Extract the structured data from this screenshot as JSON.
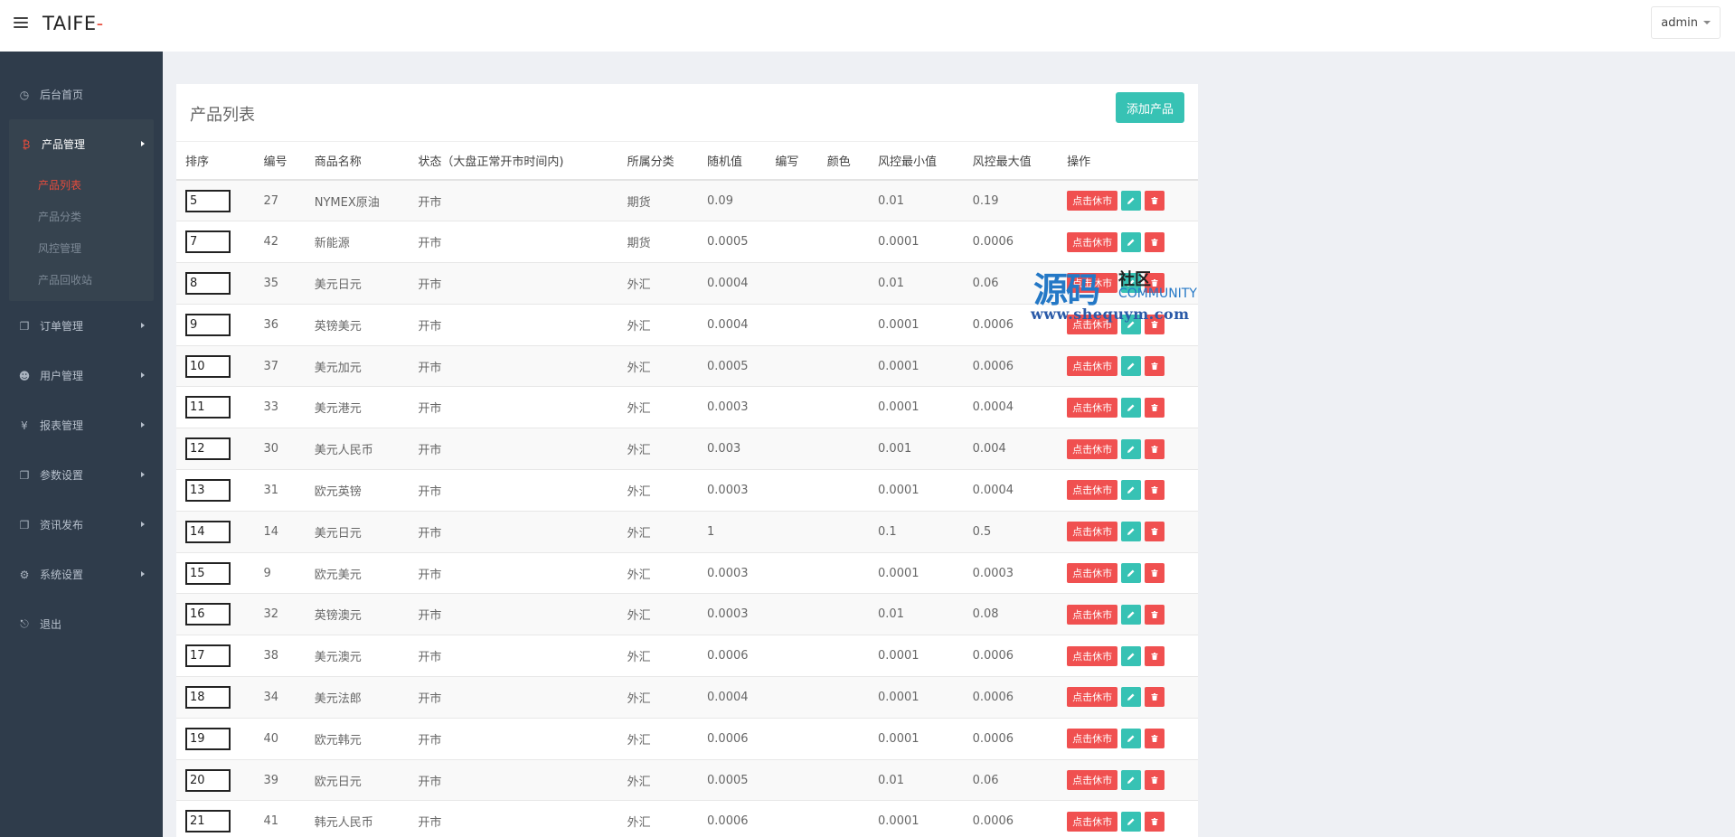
{
  "header": {
    "brand": "TAIFE",
    "brand_dash": "-",
    "user": "admin"
  },
  "sidebar": {
    "items": [
      {
        "label": "后台首页",
        "icon": "dashboard-icon",
        "glyph": "◷"
      },
      {
        "label": "产品管理",
        "icon": "bitcoin-icon",
        "glyph": "₿"
      },
      {
        "label": "订单管理",
        "icon": "copy-icon",
        "glyph": "❐"
      },
      {
        "label": "用户管理",
        "icon": "user-icon",
        "glyph": "☻"
      },
      {
        "label": "报表管理",
        "icon": "yen-icon",
        "glyph": "¥"
      },
      {
        "label": "参数设置",
        "icon": "copy-icon",
        "glyph": "❐"
      },
      {
        "label": "资讯发布",
        "icon": "copy-icon",
        "glyph": "❐"
      },
      {
        "label": "系统设置",
        "icon": "gears-icon",
        "glyph": "⚙"
      },
      {
        "label": "退出",
        "icon": "sign-out-icon",
        "glyph": "⎋"
      }
    ],
    "sub_items": [
      "产品列表",
      "产品分类",
      "风控管理",
      "产品回收站"
    ]
  },
  "main": {
    "title": "产品列表",
    "add_button": "添加产品",
    "columns": [
      "排序",
      "编号",
      "商品名称",
      "状态（大盘正常开市时间内)",
      "所属分类",
      "随机值",
      "编写",
      "颜色",
      "风控最小值",
      "风控最大值",
      "操作"
    ],
    "pause_label": "点击休市",
    "rows": [
      {
        "sort": "5",
        "id": "27",
        "name": "NYMEX原油",
        "status": "开市",
        "category": "期货",
        "random": "0.09",
        "code": "",
        "color": "",
        "min": "0.01",
        "max": "0.19"
      },
      {
        "sort": "7",
        "id": "42",
        "name": "新能源",
        "status": "开市",
        "category": "期货",
        "random": "0.0005",
        "code": "",
        "color": "",
        "min": "0.0001",
        "max": "0.0006"
      },
      {
        "sort": "8",
        "id": "35",
        "name": "美元日元",
        "status": "开市",
        "category": "外汇",
        "random": "0.0004",
        "code": "",
        "color": "",
        "min": "0.01",
        "max": "0.06"
      },
      {
        "sort": "9",
        "id": "36",
        "name": "英镑美元",
        "status": "开市",
        "category": "外汇",
        "random": "0.0004",
        "code": "",
        "color": "",
        "min": "0.0001",
        "max": "0.0006"
      },
      {
        "sort": "10",
        "id": "37",
        "name": "美元加元",
        "status": "开市",
        "category": "外汇",
        "random": "0.0005",
        "code": "",
        "color": "",
        "min": "0.0001",
        "max": "0.0006"
      },
      {
        "sort": "11",
        "id": "33",
        "name": "美元港元",
        "status": "开市",
        "category": "外汇",
        "random": "0.0003",
        "code": "",
        "color": "",
        "min": "0.0001",
        "max": "0.0004"
      },
      {
        "sort": "12",
        "id": "30",
        "name": "美元人民币",
        "status": "开市",
        "category": "外汇",
        "random": "0.003",
        "code": "",
        "color": "",
        "min": "0.001",
        "max": "0.004"
      },
      {
        "sort": "13",
        "id": "31",
        "name": "欧元英镑",
        "status": "开市",
        "category": "外汇",
        "random": "0.0003",
        "code": "",
        "color": "",
        "min": "0.0001",
        "max": "0.0004"
      },
      {
        "sort": "14",
        "id": "14",
        "name": "美元日元",
        "status": "开市",
        "category": "外汇",
        "random": "1",
        "code": "",
        "color": "",
        "min": "0.1",
        "max": "0.5"
      },
      {
        "sort": "15",
        "id": "9",
        "name": "欧元美元",
        "status": "开市",
        "category": "外汇",
        "random": "0.0003",
        "code": "",
        "color": "",
        "min": "0.0001",
        "max": "0.0003"
      },
      {
        "sort": "16",
        "id": "32",
        "name": "英镑澳元",
        "status": "开市",
        "category": "外汇",
        "random": "0.0003",
        "code": "",
        "color": "",
        "min": "0.01",
        "max": "0.08"
      },
      {
        "sort": "17",
        "id": "38",
        "name": "美元澳元",
        "status": "开市",
        "category": "外汇",
        "random": "0.0006",
        "code": "",
        "color": "",
        "min": "0.0001",
        "max": "0.0006"
      },
      {
        "sort": "18",
        "id": "34",
        "name": "美元法郎",
        "status": "开市",
        "category": "外汇",
        "random": "0.0004",
        "code": "",
        "color": "",
        "min": "0.0001",
        "max": "0.0006"
      },
      {
        "sort": "19",
        "id": "40",
        "name": "欧元韩元",
        "status": "开市",
        "category": "外汇",
        "random": "0.0006",
        "code": "",
        "color": "",
        "min": "0.0001",
        "max": "0.0006"
      },
      {
        "sort": "20",
        "id": "39",
        "name": "欧元日元",
        "status": "开市",
        "category": "外汇",
        "random": "0.0005",
        "code": "",
        "color": "",
        "min": "0.01",
        "max": "0.06"
      },
      {
        "sort": "21",
        "id": "41",
        "name": "韩元人民币",
        "status": "开市",
        "category": "外汇",
        "random": "0.0006",
        "code": "",
        "color": "",
        "min": "0.0001",
        "max": "0.0006"
      }
    ]
  },
  "watermark": {
    "main": "源码",
    "side": "社区",
    "community": "COMMUNITY",
    "url": "www.shequym.com"
  },
  "colors": {
    "sidebar_bg": "#2f3c4b",
    "accent_teal": "#37c2b4",
    "accent_red": "#f05050",
    "active_red": "#e74c3c"
  }
}
